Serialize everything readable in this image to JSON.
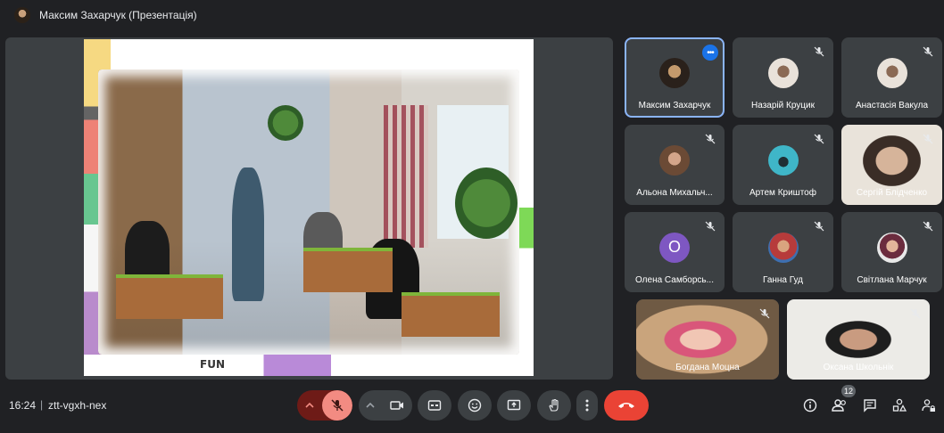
{
  "header": {
    "presenter_title": "Максим Захарчук (Презентація)"
  },
  "slide": {
    "doodle_text": "FUN"
  },
  "participants": [
    {
      "name": "Максим Захарчук",
      "active": true,
      "muted": false,
      "avatar": "photo-dark"
    },
    {
      "name": "Назарій Круцик",
      "muted": true,
      "avatar": "photo-light"
    },
    {
      "name": "Анастасія Вакула",
      "muted": true,
      "avatar": "photo-light"
    },
    {
      "name": "Альона Михальч...",
      "muted": true,
      "avatar": "photo-girl"
    },
    {
      "name": "Артем Криштоф",
      "muted": true,
      "avatar": "photo-cyan"
    },
    {
      "name": "Сергій Блідченко",
      "muted": true,
      "avatar": "video"
    },
    {
      "name": "Олена Самборсь...",
      "muted": true,
      "avatar": "letter",
      "letter": "О"
    },
    {
      "name": "Ганна Гуд",
      "muted": true,
      "avatar": "photo-red"
    },
    {
      "name": "Світлана Марчук",
      "muted": true,
      "avatar": "photo-woman"
    },
    {
      "name": "Богдана Моцна",
      "muted": true,
      "avatar": "video"
    },
    {
      "name": "Оксана Школьнік",
      "muted": true,
      "avatar": "video"
    }
  ],
  "footer": {
    "time": "16:24",
    "separator": "|",
    "meeting_code": "ztt-vgxh-nex",
    "people_count": "12"
  },
  "colors": {
    "accent": "#8ab4f8",
    "hangup": "#ea4335",
    "mic_off": "#f28b82",
    "letter_avatar": "#7e57c2"
  }
}
